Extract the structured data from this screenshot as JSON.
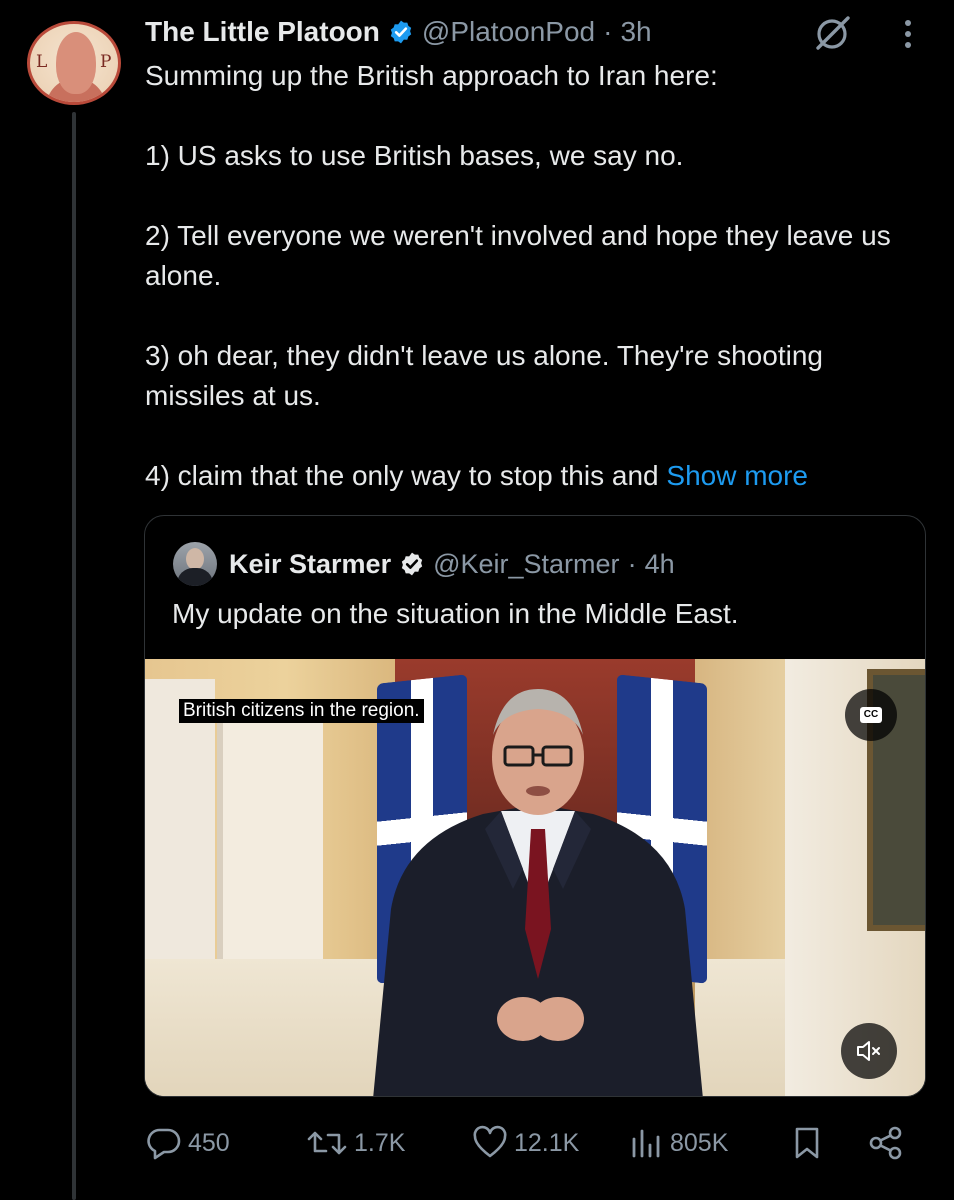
{
  "tweet": {
    "author_name": "The Little Platoon",
    "handle": "@PlatoonPod",
    "separator": "·",
    "time": "3h",
    "avatar_letters": [
      "L",
      "P"
    ],
    "lines": [
      "Summing up the British approach to Iran here:",
      "1) US asks to use British bases, we say no.",
      "2) Tell everyone we weren't involved and hope they leave us alone.",
      "3) oh dear, they didn't leave us alone. They're shooting missiles at us.",
      "4) claim that the only way to stop this and"
    ],
    "show_more": "Show more"
  },
  "quote": {
    "author_name": "Keir Starmer",
    "handle": "@Keir_Starmer",
    "separator": "·",
    "time": "4h",
    "text": "My update on the situation in the Middle East.",
    "video": {
      "caption": "British citizens in the region.",
      "cc_label": "CC"
    }
  },
  "actions": {
    "replies": "450",
    "reposts": "1.7K",
    "likes": "12.1K",
    "views": "805K"
  },
  "colors": {
    "background": "#000000",
    "text": "#e7e9ea",
    "muted": "#8b98a5",
    "link": "#1d9bf0",
    "verified": "#1d9bf0",
    "border": "#2f3336"
  }
}
